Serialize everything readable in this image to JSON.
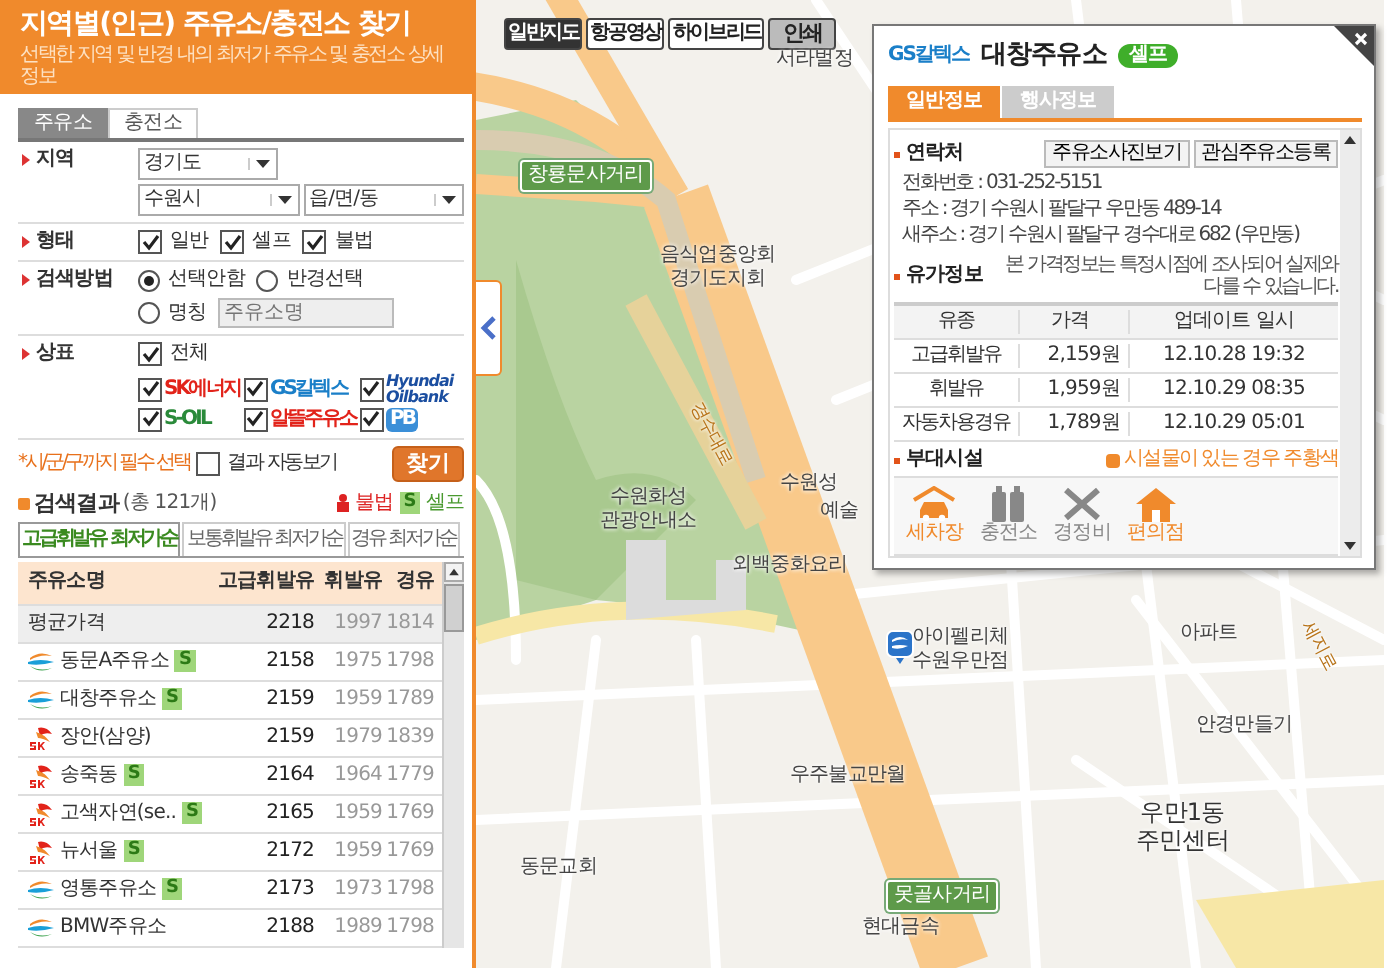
{
  "header": {
    "title": "지역별(인근) 주유소/충전소 찾기",
    "subtitle": "선택한 지역 및 반경 내의 최저가 주유소 및 충전소 상세정보"
  },
  "tabs": [
    {
      "label": "주유소",
      "selected": true
    },
    {
      "label": "충전소",
      "selected": false
    }
  ],
  "form": {
    "region": {
      "label": "지역",
      "selects": [
        "경기도",
        "수원시",
        "읍/면/동"
      ]
    },
    "type": {
      "label": "형태",
      "options": [
        {
          "label": "일반",
          "checked": true
        },
        {
          "label": "셀프",
          "checked": true
        },
        {
          "label": "불법",
          "checked": true
        }
      ]
    },
    "method": {
      "label": "검색방법",
      "options": [
        {
          "label": "선택안함",
          "selected": true
        },
        {
          "label": "반경선택",
          "selected": false
        },
        {
          "label": "명칭",
          "selected": false
        }
      ],
      "name_field": {
        "placeholder": "주유소명",
        "disabled": true
      }
    },
    "brand": {
      "label": "상표",
      "all": {
        "label": "전체",
        "checked": true
      },
      "brands": [
        {
          "name": "SK에너지",
          "kind": "sk",
          "checked": true
        },
        {
          "name": "GS칼텍스",
          "kind": "gs",
          "checked": true
        },
        {
          "name": "Hyundai Oilbank",
          "kind": "hyundai",
          "checked": true
        },
        {
          "name": "S-OIL",
          "kind": "soil",
          "checked": true
        },
        {
          "name": "알뜰주유소",
          "kind": "altteul",
          "checked": true
        },
        {
          "name": "PB",
          "kind": "pb",
          "checked": true
        }
      ]
    },
    "note": "*시/군/구까지 필수 선택",
    "auto_view": {
      "label": "결과 자동보기",
      "checked": false
    },
    "search_button": "찾기"
  },
  "results": {
    "title": "검색결과",
    "count": "(총 121개)",
    "legend": [
      {
        "kind": "illegal",
        "label": "불법"
      },
      {
        "kind": "self",
        "mark": "S",
        "label": "셀프"
      }
    ],
    "tabs": [
      {
        "label": "고급휘발유 최저가순",
        "selected": true
      },
      {
        "label": "보통휘발유 최저가순",
        "selected": false
      },
      {
        "label": "경유 최저가순",
        "selected": false
      }
    ],
    "columns": [
      "주유소명",
      "고급휘발유",
      "휘발유",
      "경유"
    ],
    "average": {
      "name": "평균가격",
      "premium": "2218",
      "gasoline": "1997",
      "diesel": "1814"
    },
    "rows": [
      {
        "kind": "gs",
        "name": "동문A주유소",
        "badge": "S",
        "premium": "2158",
        "gasoline": "1975",
        "diesel": "1798"
      },
      {
        "kind": "gs",
        "name": "대창주유소",
        "badge": "S",
        "premium": "2159",
        "gasoline": "1959",
        "diesel": "1789"
      },
      {
        "kind": "sk",
        "name": "장안(삼양)",
        "premium": "2159",
        "gasoline": "1979",
        "diesel": "1839"
      },
      {
        "kind": "sk",
        "name": "송죽동",
        "badge": "S",
        "premium": "2164",
        "gasoline": "1964",
        "diesel": "1779"
      },
      {
        "kind": "sk",
        "name": "고색자연(se..",
        "badge": "S",
        "premium": "2165",
        "gasoline": "1959",
        "diesel": "1769"
      },
      {
        "kind": "sk",
        "name": "뉴서울",
        "badge": "S",
        "premium": "2172",
        "gasoline": "1959",
        "diesel": "1769"
      },
      {
        "kind": "gs",
        "name": "영통주유소",
        "badge": "S",
        "premium": "2173",
        "gasoline": "1973",
        "diesel": "1798"
      },
      {
        "kind": "gs",
        "name": "BMW주유소",
        "premium": "2188",
        "gasoline": "1989",
        "diesel": "1798"
      }
    ]
  },
  "map": {
    "buttons": [
      {
        "label": "일반지도",
        "kind": "maptype",
        "selected": true
      },
      {
        "label": "항공영상",
        "kind": "maptype",
        "selected": false
      },
      {
        "label": "하이브리드",
        "kind": "maptype",
        "selected": false
      },
      {
        "label": "인쇄",
        "kind": "print",
        "selected": false
      }
    ],
    "labels": [
      {
        "text": "서라벌정",
        "kind": "place"
      },
      {
        "text": "창룡문사거리",
        "kind": "sign"
      },
      {
        "text": "음식업중앙회\n경기도지회",
        "kind": "place"
      },
      {
        "text": "경수대로",
        "kind": "road"
      },
      {
        "text": "수원성",
        "kind": "place"
      },
      {
        "text": "예술",
        "kind": "place"
      },
      {
        "text": "수원화성\n관광안내소",
        "kind": "place"
      },
      {
        "text": "외백중화요리",
        "kind": "place"
      },
      {
        "text": "아이펠리체\n수원우만점",
        "kind": "place"
      },
      {
        "text": "우주불교만월",
        "kind": "place"
      },
      {
        "text": "동문교회",
        "kind": "place"
      },
      {
        "text": "못골사거리",
        "kind": "sign"
      },
      {
        "text": "현대금속",
        "kind": "place"
      },
      {
        "text": "아파트",
        "kind": "place"
      },
      {
        "text": "세지로",
        "kind": "road"
      },
      {
        "text": "안경만들기",
        "kind": "place"
      },
      {
        "text": "우만1동\n주민센터",
        "kind": "big"
      }
    ]
  },
  "popup": {
    "brand_logo": "GS칼텍스",
    "name": "대창주유소",
    "badge": "셀프",
    "tabs": [
      {
        "label": "일반정보",
        "selected": true
      },
      {
        "label": "행사정보",
        "selected": false
      }
    ],
    "contact": {
      "title": "연락처",
      "buttons": [
        "주유소사진보기",
        "관심주유소등록"
      ],
      "lines": [
        "전화번호 : 031-252-5151",
        "주소 : 경기 수원시 팔달구 우만동 489-14",
        "새주소 : 경기 수원시 팔달구 경수대로 682 (우만동)"
      ]
    },
    "price": {
      "title": "유가정보",
      "note": "본 가격정보는 특정시점에 조사되어 실제와 다를 수 있습니다.",
      "columns": [
        "유종",
        "가격",
        "업데이트 일시"
      ],
      "rows": [
        [
          "고급휘발유",
          "2,159원",
          "12.10.28 19:32"
        ],
        [
          "휘발유",
          "1,959원",
          "12.10.29 08:35"
        ],
        [
          "자동차용경유",
          "1,789원",
          "12.10.29 05:01"
        ]
      ]
    },
    "facilities": {
      "title": "부대시설",
      "legend": "시설물이 있는 경우 주황색",
      "items": [
        {
          "label": "세차장",
          "kind": "carwash",
          "on": true
        },
        {
          "label": "충전소",
          "kind": "charger",
          "on": false
        },
        {
          "label": "경정비",
          "kind": "repair",
          "on": false
        },
        {
          "label": "편의점",
          "kind": "store",
          "on": true
        }
      ]
    }
  }
}
